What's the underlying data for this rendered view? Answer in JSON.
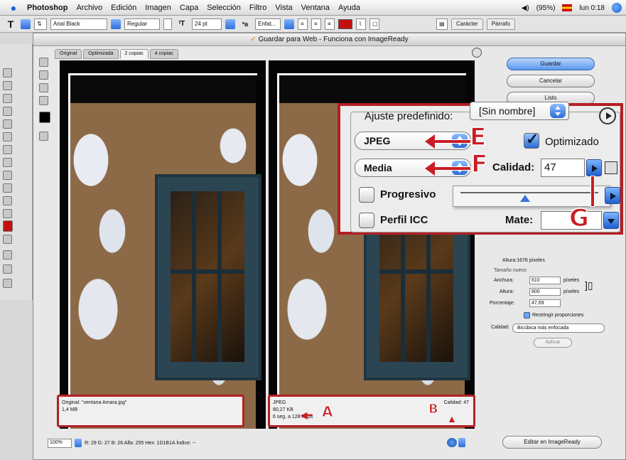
{
  "menubar": {
    "items": [
      "Photoshop",
      "Archivo",
      "Edición",
      "Imagen",
      "Capa",
      "Selección",
      "Filtro",
      "Vista",
      "Ventana",
      "Ayuda"
    ],
    "battery": "(95%)",
    "clock": "lun 0:18"
  },
  "options": {
    "font_family": "Arial Black",
    "font_style": "Regular",
    "font_size": "24 pt",
    "antialias": "Enfat...",
    "palette_tabs": [
      "Carácter",
      "Párrafo"
    ]
  },
  "dialog": {
    "title": "Guardar para Web - Funciona con ImageReady",
    "tabs": [
      "Original",
      "Optimizada",
      "2 copias",
      "4 copias"
    ],
    "active_tab": 2
  },
  "buttons": {
    "save": "Guardar",
    "cancel": "Cancelar",
    "done": "Listo",
    "edit_imageready": "Editar en ImageReady",
    "apply": "Aplicar"
  },
  "original_info": {
    "line1": "Original: \"ventana Amara.jpg\"",
    "line2": "1,4 MB"
  },
  "optimized_info": {
    "line1": "JPEG",
    "line2": "80,27 KB",
    "line3": "6 seg. a 128 Kbps",
    "quality": "Calidad: 47"
  },
  "callouts": {
    "A": "A",
    "B": "B",
    "E": "E",
    "F": "F",
    "G": "G"
  },
  "settings": {
    "preset_label": "Ajuste predefinido:",
    "preset_value": "[Sin nombre]",
    "format": "JPEG",
    "optimized_label": "Optimizado",
    "optimized_checked": true,
    "quality_preset": "Media",
    "quality_label": "Calidad:",
    "quality_value": "47",
    "quality_fraction": 0.47,
    "progressive_label": "Progresivo",
    "icc_label": "Perfil ICC",
    "matte_label": "Mate:"
  },
  "image_size": {
    "height_info": "Altura:1678 píxeles",
    "group_label": "Tamaño nuevo",
    "width_label": "Anchura:",
    "width_value": "610",
    "height_label": "Altura:",
    "height_value": "800",
    "unit": "píxeles",
    "percent_label": "Porcentaje:",
    "percent_value": "47,69",
    "constrain_label": "Restringir proporciones",
    "quality_label": "Calidad:",
    "quality_value": "Bicúbica más enfocada"
  },
  "status": {
    "zoom": "100%",
    "readout": "R: 29  G: 27  B: 26  Alfa: 255  Hex: 1D1B1A  Índice: --"
  },
  "colors": {
    "accent": "#b31f24",
    "blue": "#2f6fd8"
  },
  "icons": [
    "apple-icon",
    "volume-icon",
    "flag-icon",
    "spotlight-icon",
    "text-tool-icon",
    "menu-arrow-icon",
    "palette-icon"
  ]
}
